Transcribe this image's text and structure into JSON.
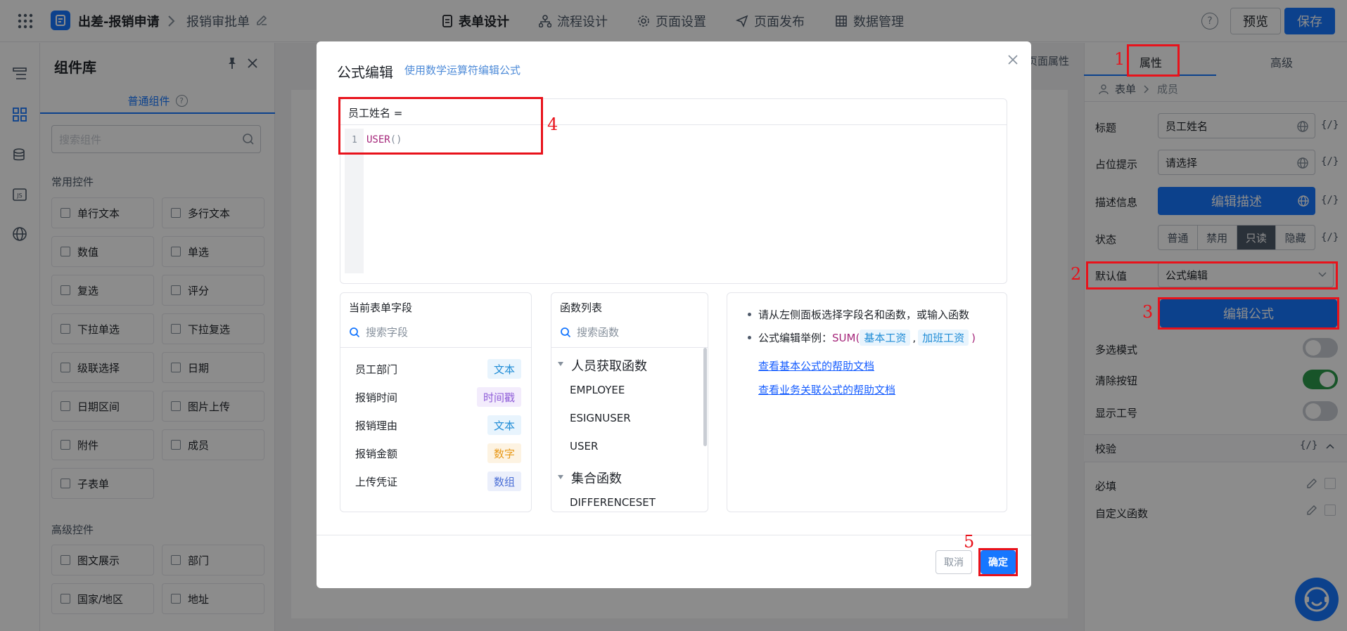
{
  "header": {
    "app_name": "出差-报销申请",
    "form_name": "报销审批单",
    "tabs": [
      "表单设计",
      "流程设计",
      "页面设置",
      "页面发布",
      "数据管理"
    ],
    "preview_label": "预览",
    "save_label": "保存"
  },
  "library": {
    "title": "组件库",
    "tab_label": "普通组件",
    "search_placeholder": "搜索组件",
    "common_title": "常用控件",
    "common_items": [
      "单行文本",
      "多行文本",
      "数值",
      "单选",
      "复选",
      "评分",
      "下拉单选",
      "下拉复选",
      "级联选择",
      "日期",
      "日期区间",
      "图片上传",
      "附件",
      "成员",
      "子表单"
    ],
    "advanced_title": "高级控件",
    "advanced_items": [
      "图文展示",
      "部门",
      "国家/地区",
      "地址"
    ]
  },
  "canvas": {
    "page_props_label": "页面属性"
  },
  "right_panel": {
    "tabs": [
      "属性",
      "高级"
    ],
    "breadcrumb": [
      "表单",
      "成员"
    ],
    "title_label": "标题",
    "title_value": "员工姓名",
    "placeholder_label": "占位提示",
    "placeholder_value": "请选择",
    "desc_label": "描述信息",
    "desc_button": "编辑描述",
    "status_label": "状态",
    "status_options": [
      "普通",
      "禁用",
      "只读",
      "隐藏"
    ],
    "status_selected": "只读",
    "default_label": "默认值",
    "default_value": "公式编辑",
    "edit_formula_button": "编辑公式",
    "multi_label": "多选模式",
    "clear_label": "清除按钮",
    "show_id_label": "显示工号",
    "toggles": {
      "multi": false,
      "clear": true,
      "show_id": false
    },
    "validate_title": "校验",
    "required_label": "必填",
    "custom_fn_label": "自定义函数",
    "fx_symbol": "{/}"
  },
  "modal": {
    "title": "公式编辑",
    "subtitle": "使用数学运算符编辑公式",
    "formula_field": "员工姓名 =",
    "line_number": "1",
    "formula_fn": "USER",
    "formula_parens": "()",
    "fields_title": "当前表单字段",
    "fields_search": "搜索字段",
    "fields": [
      {
        "name": "员工部门",
        "type": "文本",
        "color": "#1f8cd6",
        "bg": "#e8f4fd"
      },
      {
        "name": "报销时间",
        "type": "时间戳",
        "color": "#8e5bd8",
        "bg": "#f3ecfc"
      },
      {
        "name": "报销理由",
        "type": "文本",
        "color": "#1f8cd6",
        "bg": "#e8f4fd"
      },
      {
        "name": "报销金额",
        "type": "数字",
        "color": "#e89a1b",
        "bg": "#fdf3e2"
      },
      {
        "name": "上传凭证",
        "type": "数组",
        "color": "#4b6fd6",
        "bg": "#ebeffb"
      }
    ],
    "fn_title": "函数列表",
    "fn_search": "搜索函数",
    "fn_group1": "人员获取函数",
    "fn_group1_items": [
      "EMPLOYEE",
      "ESIGNUSER",
      "USER"
    ],
    "fn_group2": "集合函数",
    "fn_group2_items": [
      "DIFFERENCESET"
    ],
    "help_line1": "请从左侧面板选择字段名和函数，或输入函数",
    "help_line2_prefix": "公式编辑举例：",
    "help_example_fn": "SUM(",
    "help_example_arg1": "基本工资",
    "help_example_sep": ",",
    "help_example_arg2": "加班工资",
    "help_example_close": ")",
    "help_link1": "查看基本公式的帮助文档",
    "help_link2": "查看业务关联公式的帮助文档",
    "cancel_label": "取消",
    "ok_label": "确定"
  },
  "annotations": [
    "1",
    "2",
    "3",
    "4",
    "5"
  ]
}
